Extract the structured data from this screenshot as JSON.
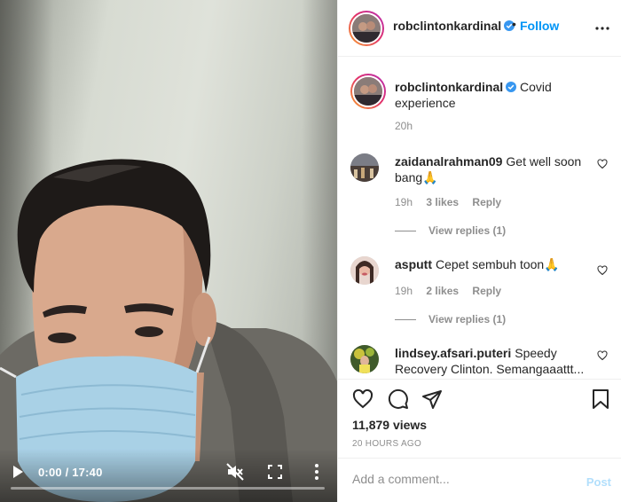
{
  "video": {
    "time": "0:00 / 17:40",
    "progress": 0,
    "icons": {
      "play": "play-icon",
      "mute": "mute-icon",
      "fullscreen": "fullscreen-icon",
      "more": "more-vertical-icon"
    }
  },
  "header": {
    "username": "robclintonkardinal",
    "separator": "•",
    "follow_label": "Follow",
    "verified": true
  },
  "caption": {
    "username": "robclintonkardinal",
    "text": "Covid experience",
    "time": "20h"
  },
  "comments": [
    {
      "username": "zaidanalrahman09",
      "text": "Get well soon bang🙏",
      "time": "19h",
      "likes": "3 likes",
      "reply": "Reply",
      "view_replies": "View replies (1)"
    },
    {
      "username": "asputt",
      "text": "Cepet sembuh toon🙏",
      "time": "19h",
      "likes": "2 likes",
      "reply": "Reply",
      "view_replies": "View replies (1)"
    },
    {
      "username": "lindsey.afsari.puteri",
      "text": "Speedy Recovery Clinton. Semangaaattt...",
      "time": "",
      "likes": "",
      "reply": "",
      "view_replies": ""
    }
  ],
  "actions": {
    "views": "11,879 views",
    "age": "20 HOURS AGO",
    "icons": [
      "heart-icon",
      "comment-icon",
      "share-icon",
      "save-icon"
    ]
  },
  "add_comment": {
    "placeholder": "Add a comment...",
    "post_label": "Post"
  },
  "colors": {
    "accent": "#0095f6",
    "post_disabled": "#b2dffc",
    "muted_text": "#8e8e8e",
    "verified": "#3897f0"
  }
}
